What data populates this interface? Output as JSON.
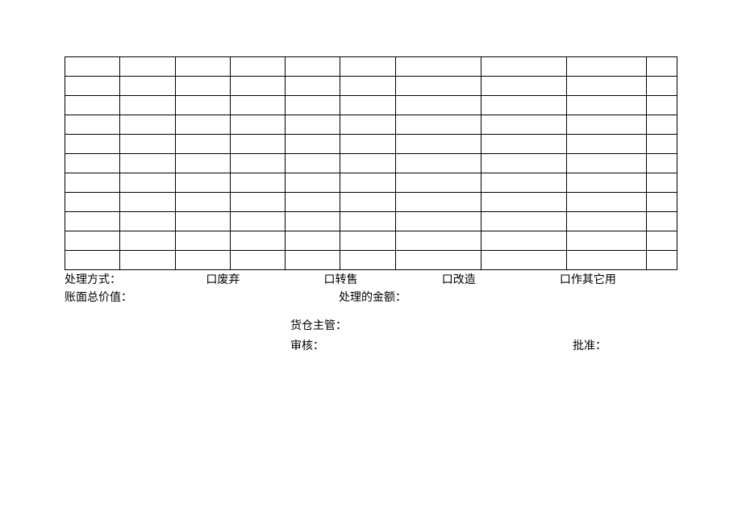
{
  "options": {
    "label": "处理方式：",
    "opt1": "口废弃",
    "opt2": "口转售",
    "opt3": "口改造",
    "opt4": "口作其它用"
  },
  "amount": {
    "left": "账面总价值：",
    "right": "处理的金额："
  },
  "signatures": {
    "warehouse": "货仓主管：",
    "review": "审核：",
    "approve": "批准："
  }
}
